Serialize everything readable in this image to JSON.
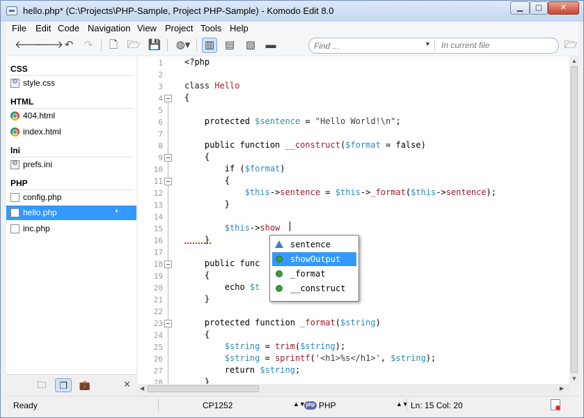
{
  "window": {
    "title": "hello.php* (C:\\Projects\\PHP-Sample, Project PHP-Sample) - Komodo Edit 8.0",
    "controls": {
      "minimize": "▁",
      "maximize": "▢",
      "close": "✕"
    }
  },
  "menu": [
    "File",
    "Edit",
    "Code",
    "Navigation",
    "View",
    "Project",
    "Tools",
    "Help"
  ],
  "toolbar": {
    "icons": [
      "back-icon",
      "forward-icon",
      "undo-icon",
      "redo-icon",
      "new-file-icon",
      "open-folder-icon",
      "save-icon",
      "browser-preview-icon",
      "left-pane-icon",
      "bottom-pane-icon",
      "right-pane-icon",
      "fullscreen-icon"
    ],
    "find_placeholder": "Find ...",
    "find_scope": "In current file"
  },
  "sidebar": {
    "groups": [
      {
        "name": "CSS",
        "files": [
          {
            "name": "style.css",
            "icon": "gear-doc-icon"
          }
        ]
      },
      {
        "name": "HTML",
        "files": [
          {
            "name": "404.html",
            "icon": "chrome-icon"
          },
          {
            "name": "index.html",
            "icon": "chrome-icon"
          }
        ]
      },
      {
        "name": "Ini",
        "files": [
          {
            "name": "prefs.ini",
            "icon": "gear-doc-icon"
          }
        ]
      },
      {
        "name": "PHP",
        "files": [
          {
            "name": "config.php",
            "icon": "doc-icon"
          },
          {
            "name": "hello.php",
            "icon": "doc-icon",
            "selected": true,
            "modified": "*"
          },
          {
            "name": "inc.php",
            "icon": "doc-icon"
          }
        ]
      }
    ],
    "bottom_close": "✕"
  },
  "editor": {
    "line_numbers": [
      "1",
      "2",
      "3",
      "4",
      "5",
      "6",
      "7",
      "8",
      "9",
      "10",
      "11",
      "12",
      "13",
      "14",
      "15",
      "16",
      "17",
      "18",
      "19",
      "20",
      "21",
      "22",
      "23",
      "24",
      "25",
      "26",
      "27",
      "28"
    ],
    "lines": [
      "<?php",
      "",
      "class Hello",
      "{",
      "",
      "    protected $sentence = \"Hello World!\\n\";",
      "",
      "    public function __construct($format = false)",
      "    {",
      "        if ($format)",
      "        {",
      "            $this->sentence = $this->_format($this->sentence);",
      "        }",
      "",
      "        $this->show",
      "    }",
      "",
      "    public func",
      "    {",
      "        echo $t",
      "    }",
      "",
      "    protected function _format($string)",
      "    {",
      "        $string = trim($string);",
      "        $string = sprintf('<h1>%s</h1>', $string);",
      "        return $string;",
      "    }"
    ],
    "autocomplete": [
      {
        "label": "sentence",
        "icon": "property-icon"
      },
      {
        "label": "showOutput",
        "icon": "method-icon",
        "selected": true
      },
      {
        "label": "_format",
        "icon": "method-icon"
      },
      {
        "label": "__construct",
        "icon": "method-icon"
      }
    ]
  },
  "status": {
    "state": "Ready",
    "encoding": "CP1252",
    "language_badge": "php",
    "language": "PHP",
    "position": "Ln: 15 Col: 20"
  }
}
